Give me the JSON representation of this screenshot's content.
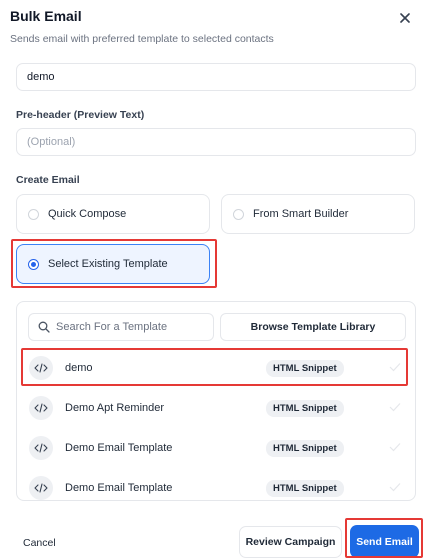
{
  "dialog": {
    "title": "Bulk Email",
    "subtitle": "Sends email with preferred template to selected contacts"
  },
  "form": {
    "subject_value": "demo",
    "preheader_label": "Pre-header (Preview Text)",
    "preheader_placeholder": "(Optional)",
    "create_email_label": "Create Email"
  },
  "options": {
    "quick_compose": "Quick Compose",
    "smart_builder": "From Smart Builder",
    "existing_template": "Select Existing Template",
    "selected": "existing_template"
  },
  "templates": {
    "search_placeholder": "Search For a Template",
    "browse_label": "Browse Template Library",
    "rows": [
      {
        "name": "demo",
        "badge": "HTML Snippet"
      },
      {
        "name": "Demo Apt Reminder",
        "badge": "HTML Snippet"
      },
      {
        "name": "Demo Email Template",
        "badge": "HTML Snippet"
      },
      {
        "name": "Demo Email Template",
        "badge": "HTML Snippet"
      }
    ]
  },
  "footer": {
    "cancel_label": "Cancel",
    "review_label": "Review Campaign",
    "send_label": "Send Email"
  },
  "colors": {
    "accent": "#1d6ae5",
    "highlight": "#e53935",
    "selected_bg": "#eef4ff"
  }
}
